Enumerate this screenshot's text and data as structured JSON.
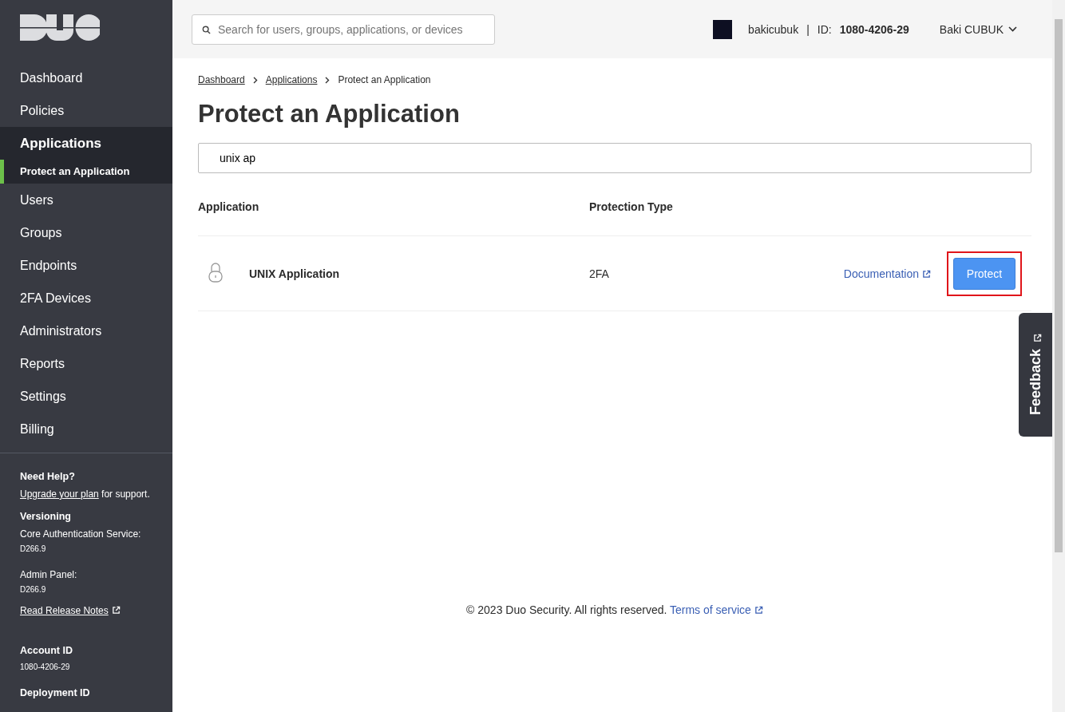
{
  "sidebar": {
    "nav": [
      {
        "label": "Dashboard",
        "selected": false
      },
      {
        "label": "Policies",
        "selected": false
      },
      {
        "label": "Applications",
        "selected": true,
        "children": [
          {
            "label": "Protect an Application",
            "selected": true
          }
        ]
      },
      {
        "label": "Users",
        "selected": false
      },
      {
        "label": "Groups",
        "selected": false
      },
      {
        "label": "Endpoints",
        "selected": false
      },
      {
        "label": "2FA Devices",
        "selected": false
      },
      {
        "label": "Administrators",
        "selected": false
      },
      {
        "label": "Reports",
        "selected": false
      },
      {
        "label": "Settings",
        "selected": false
      },
      {
        "label": "Billing",
        "selected": false
      }
    ],
    "help": {
      "title": "Need Help?",
      "link": "Upgrade your plan",
      "text": " for support."
    },
    "versioning": {
      "title": "Versioning",
      "items": [
        {
          "label": "Core Authentication Service:",
          "value": "D266.9"
        },
        {
          "label": "Admin Panel:",
          "value": "D266.9"
        }
      ],
      "release_notes": "Read Release Notes"
    },
    "account": {
      "title": "Account ID",
      "value": "1080-4206-29"
    },
    "deployment": {
      "title": "Deployment ID"
    }
  },
  "topbar": {
    "search": {
      "placeholder": "Search for users, groups, applications, or devices"
    },
    "username": "bakicubuk",
    "separator": "|",
    "id_label": "ID:",
    "id_value": "1080-4206-29",
    "account_name": "Baki CUBUK"
  },
  "breadcrumbs": [
    "Dashboard",
    "Applications",
    "Protect an Application"
  ],
  "title": "Protect an Application",
  "filter": {
    "value": "unix ap"
  },
  "table": {
    "columns": [
      "Application",
      "Protection Type"
    ],
    "rows": [
      {
        "name": "UNIX Application",
        "protection": "2FA",
        "doc_link": "Documentation",
        "action": "Protect",
        "highlighted": true
      }
    ]
  },
  "footer": {
    "text": "© 2023 Duo Security. All rights reserved. ",
    "link": "Terms of service"
  },
  "feedback": "Feedback"
}
